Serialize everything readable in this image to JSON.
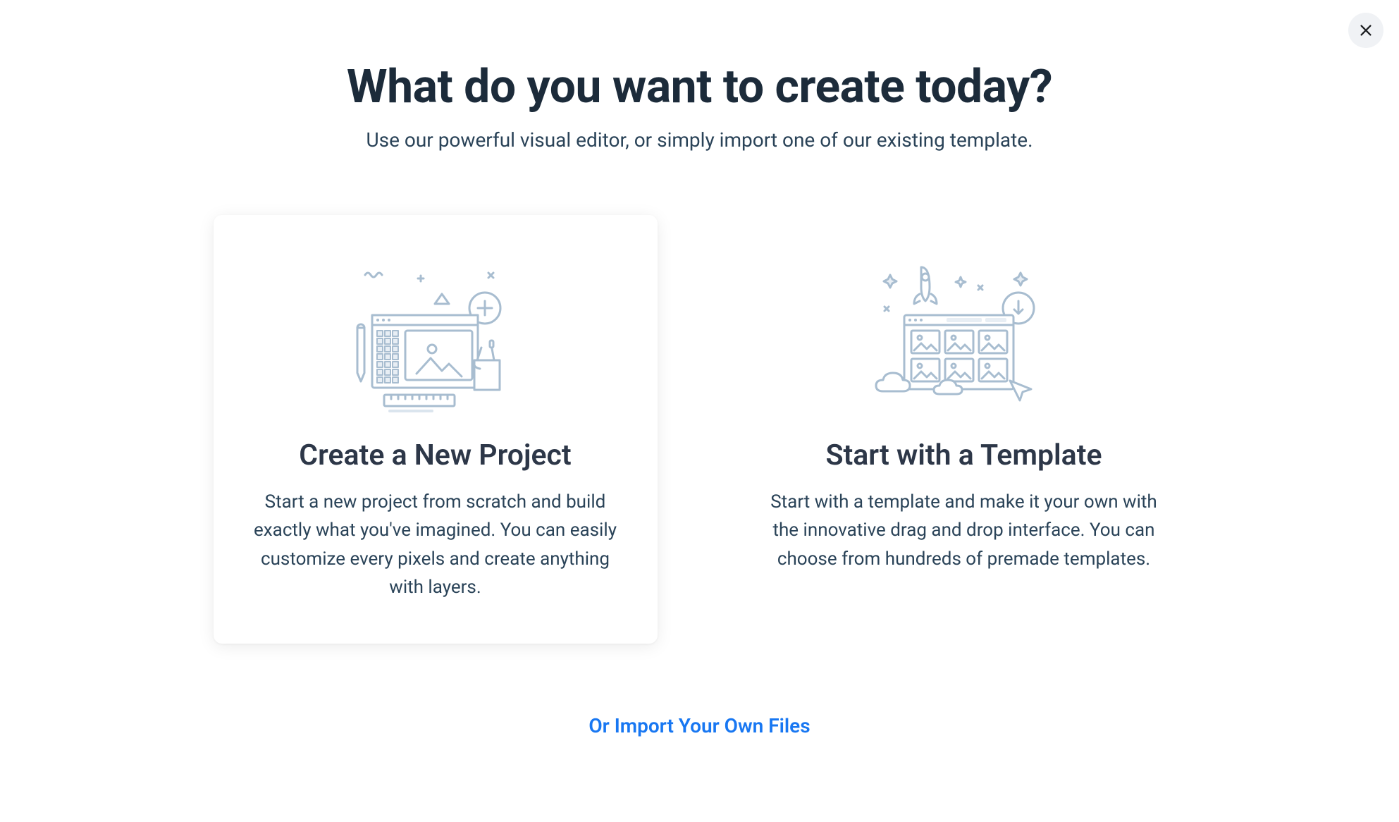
{
  "header": {
    "title": "What do you want to create today?",
    "subtitle": "Use our powerful visual editor, or simply import one of our existing template."
  },
  "cards": {
    "new_project": {
      "title": "Create a New Project",
      "description": "Start a new project from scratch and build exactly what you've imagined. You can easily customize every pixels and create anything with layers."
    },
    "template": {
      "title": "Start with a Template",
      "description": "Start with a template and make it your own with the innovative drag and drop interface. You can choose from hundreds of premade templates."
    }
  },
  "import_link": "Or Import Your Own Files",
  "colors": {
    "heading": "#1c2b3a",
    "subheading": "#2a4358",
    "link": "#1877f2",
    "illustration_stroke": "#a8bdd0",
    "illustration_fill": "#ffffff",
    "close_bg": "#f0f2f5"
  }
}
